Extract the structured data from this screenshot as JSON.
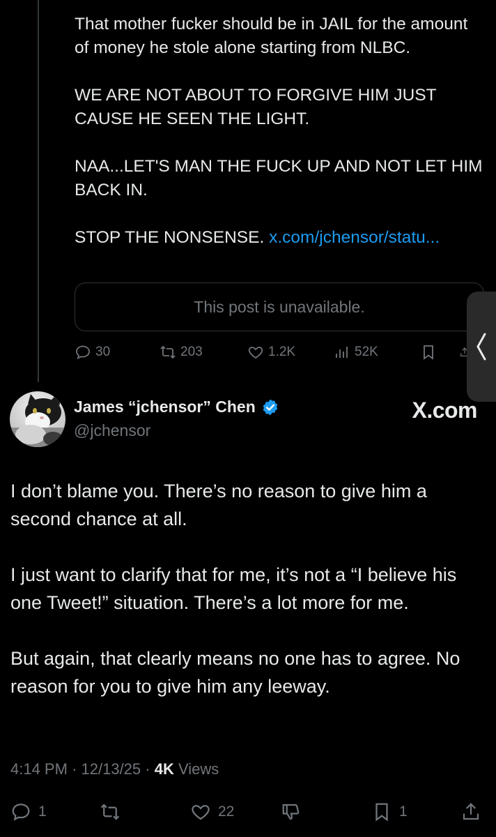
{
  "parent_tweet": {
    "lines": [
      "That mother fucker should be in JAIL for the amount of money he stole alone starting from NLBC.",
      "WE ARE NOT ABOUT TO FORGIVE HIM JUST CAUSE HE SEEN THE LIGHT.",
      "NAA...LET'S MAN THE FUCK UP AND NOT LET HIM BACK IN."
    ],
    "last_line_text": "STOP THE NONSENSE.",
    "link_text": "x.com/jchensor/statu...",
    "quoted_card_text": "This post is unavailable.",
    "actions": {
      "replies": "30",
      "reposts": "203",
      "likes": "1.2K",
      "views": "52K"
    }
  },
  "main_tweet": {
    "author_name": "James “jchensor” Chen",
    "author_handle": "@jchensor",
    "watermark": "X.com",
    "paragraphs": [
      "I don’t blame you. There’s no reason to give him a second chance at all.",
      "I just want to clarify that for me, it’s not a “I believe his one Tweet!” situation. There’s a lot more for me.",
      "But again, that clearly means no one has to agree. No reason for you to give him any leeway."
    ],
    "time": "4:14 PM",
    "date": "12/13/25",
    "views_count": "4K",
    "views_label": "Views",
    "actions": {
      "replies": "1",
      "likes": "22",
      "bookmarks": "1"
    }
  },
  "icons": {
    "reply": "reply-icon",
    "repost": "repost-icon",
    "like": "heart-icon",
    "views": "views-icon",
    "bookmark": "bookmark-icon",
    "share": "share-icon",
    "dislike": "dislike-icon",
    "verified": "verified-badge-icon"
  },
  "colors": {
    "background": "#000000",
    "text": "#e7e9ea",
    "muted": "#71767b",
    "link": "#1d9bf0",
    "border": "#2f3336"
  }
}
